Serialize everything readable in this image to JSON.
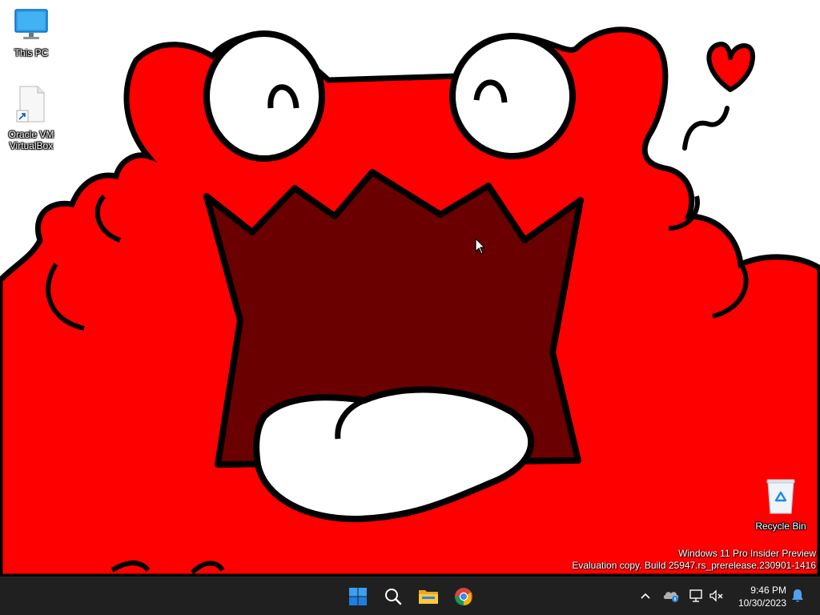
{
  "desktop": {
    "icons": [
      {
        "label": "This PC",
        "icon": "monitor-icon"
      },
      {
        "label": "Oracle VM VirtualBox",
        "icon": "shortcut-file-icon"
      },
      {
        "label": "Recycle Bin",
        "icon": "recycle-bin-icon"
      }
    ],
    "wallpaper": {
      "colors": {
        "body": "#ff0000",
        "mouth": "#6b0000",
        "outline": "#000000",
        "eyes": "#ffffff"
      }
    },
    "watermark": {
      "line1": "Windows 11 Pro Insider Preview",
      "line2": "Evaluation copy. Build 25947.rs_prerelease.230901-1416"
    }
  },
  "taskbar": {
    "background": "#202020",
    "pinned": [
      {
        "icon": "windows-start-icon"
      },
      {
        "icon": "search-icon"
      },
      {
        "icon": "file-explorer-icon"
      },
      {
        "icon": "chrome-icon"
      }
    ],
    "tray": {
      "icons": [
        "chevron-up-icon",
        "onedrive-icon",
        "network-icon",
        "volume-muted-icon",
        "notification-bell-icon"
      ]
    },
    "clock": {
      "time": "9:46 PM",
      "date": "10/30/2023"
    }
  }
}
